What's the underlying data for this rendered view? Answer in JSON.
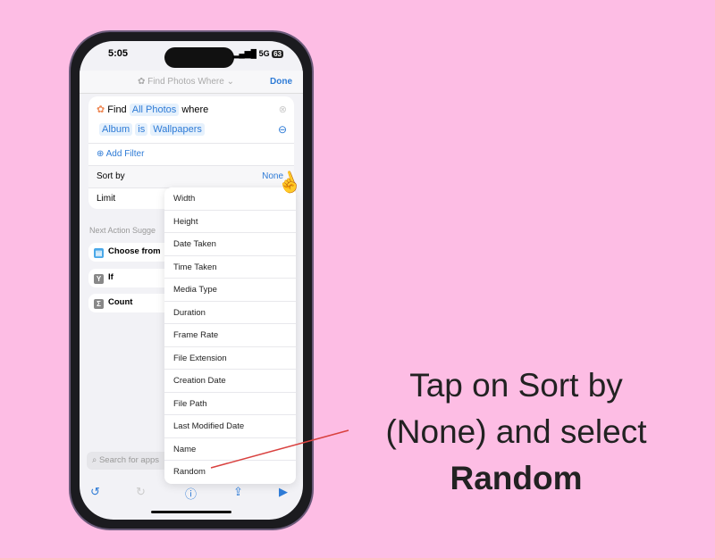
{
  "status": {
    "time": "5:05",
    "network": "5G",
    "battery": "63"
  },
  "nav": {
    "title": "Find Photos Where",
    "done": "Done"
  },
  "action": {
    "find": "Find",
    "source": "All Photos",
    "where": "where",
    "filter_field": "Album",
    "filter_op": "is",
    "filter_value": "Wallpapers",
    "add_filter": "Add Filter",
    "sort_label": "Sort by",
    "sort_value": "None",
    "limit_label": "Limit"
  },
  "suggestions": {
    "header": "Next Action Sugge",
    "items": [
      "Choose from",
      "If",
      "Count"
    ]
  },
  "menu": [
    "Width",
    "Height",
    "Date Taken",
    "Time Taken",
    "Media Type",
    "Duration",
    "Frame Rate",
    "File Extension",
    "Creation Date",
    "File Path",
    "Last Modified Date",
    "Name",
    "Random"
  ],
  "search": {
    "placeholder": "Search for apps"
  },
  "caption": {
    "line1": "Tap on Sort by",
    "line2": "(None) and select",
    "line3": "Random"
  },
  "colors": {
    "background": "#fdbde4",
    "accent": "#2e7bd6",
    "arrow": "#d9413f"
  }
}
